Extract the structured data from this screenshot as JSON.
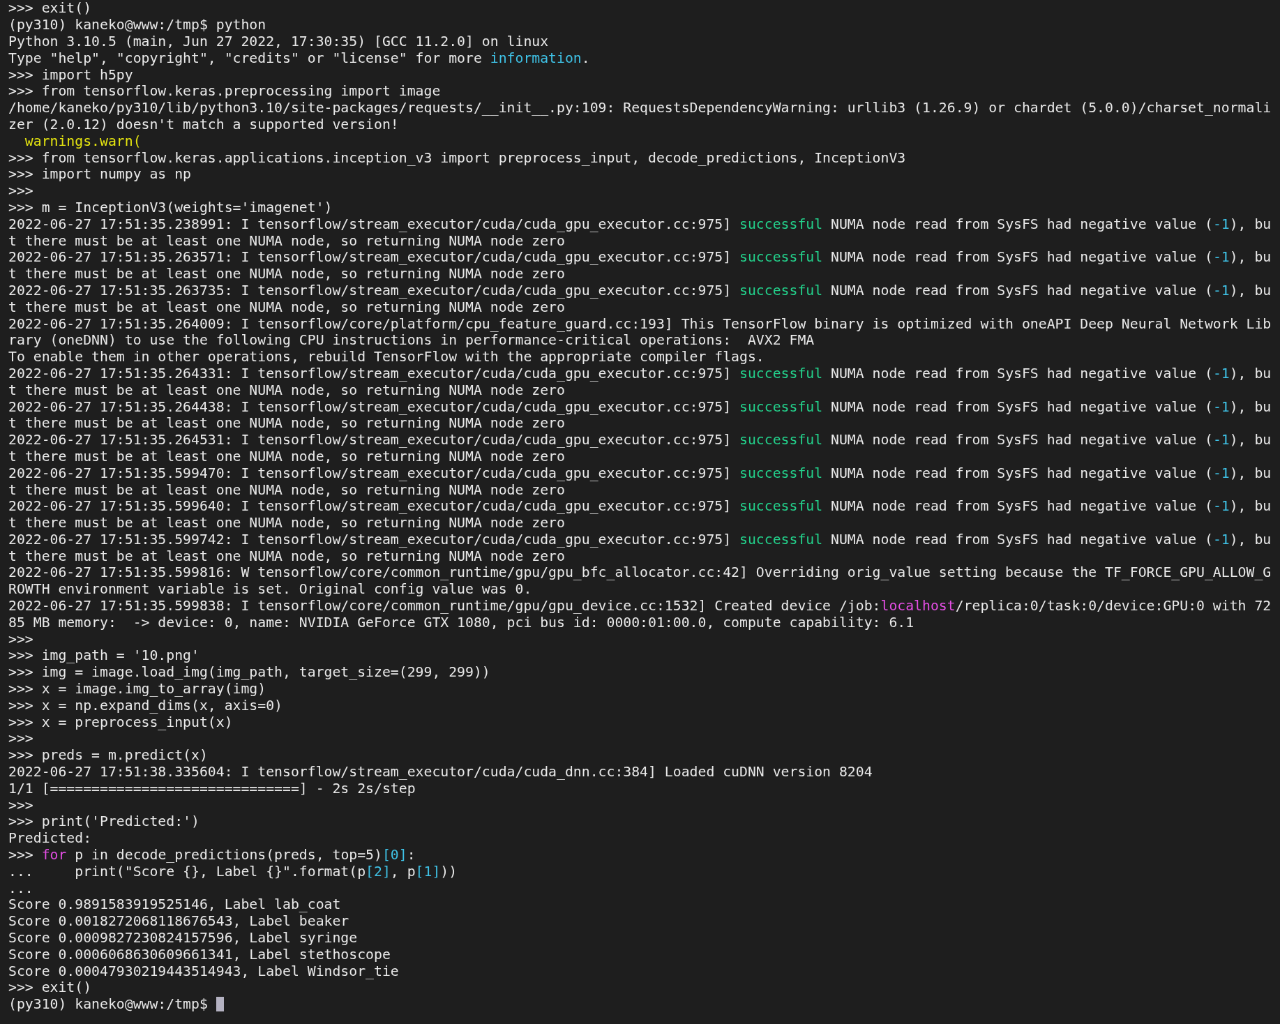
{
  "terminal": {
    "cursor": true,
    "lines": [
      {
        "segments": [
          {
            "text": ">>> exit()"
          }
        ]
      },
      {
        "segments": [
          {
            "text": "(py310) kaneko@www:/tmp$ python"
          }
        ]
      },
      {
        "segments": [
          {
            "text": "Python 3.10.5 (main, Jun 27 2022, 17:30:35) [GCC 11.2.0] on linux"
          }
        ]
      },
      {
        "segments": [
          {
            "text": "Type \"help\", \"copyright\", \"credits\" or \"license\" for more "
          },
          {
            "text": "information",
            "color": "#3fc2e6"
          },
          {
            "text": "."
          }
        ]
      },
      {
        "segments": [
          {
            "text": ">>> import h5py"
          }
        ]
      },
      {
        "segments": [
          {
            "text": ">>> from tensorflow.keras.preprocessing import image"
          }
        ]
      },
      {
        "segments": [
          {
            "text": "/home/kaneko/py310/lib/python3.10/site-packages/requests/__init__.py:109: RequestsDependencyWarning: urllib3 (1.26.9) or chardet (5.0.0)/charset_normali"
          }
        ]
      },
      {
        "segments": [
          {
            "text": "zer (2.0.12) doesn't match a supported version!"
          }
        ]
      },
      {
        "segments": [
          {
            "text": "  warnings.warn(",
            "color": "#e5e510"
          }
        ]
      },
      {
        "segments": [
          {
            "text": ">>> from tensorflow.keras.applications.inception_v3 import preprocess_input, decode_predictions, InceptionV3"
          }
        ]
      },
      {
        "segments": [
          {
            "text": ">>> import numpy as np"
          }
        ]
      },
      {
        "segments": [
          {
            "text": ">>>"
          }
        ]
      },
      {
        "segments": [
          {
            "text": ">>> m = InceptionV3(weights='imagenet')"
          }
        ]
      },
      {
        "segments": [
          {
            "text": "2022-06-27 17:51:35.238991: I tensorflow/stream_executor/cuda/cuda_gpu_executor.cc:975] "
          },
          {
            "text": "successful",
            "color": "#23d18b"
          },
          {
            "text": " NUMA node read from SysFS had negative value ("
          },
          {
            "text": "-1",
            "color": "#3fc2e6"
          },
          {
            "text": "), bu"
          }
        ]
      },
      {
        "segments": [
          {
            "text": "t there must be at least one NUMA node, so returning NUMA node zero"
          }
        ]
      },
      {
        "segments": [
          {
            "text": "2022-06-27 17:51:35.263571: I tensorflow/stream_executor/cuda/cuda_gpu_executor.cc:975] "
          },
          {
            "text": "successful",
            "color": "#23d18b"
          },
          {
            "text": " NUMA node read from SysFS had negative value ("
          },
          {
            "text": "-1",
            "color": "#3fc2e6"
          },
          {
            "text": "), bu"
          }
        ]
      },
      {
        "segments": [
          {
            "text": "t there must be at least one NUMA node, so returning NUMA node zero"
          }
        ]
      },
      {
        "segments": [
          {
            "text": "2022-06-27 17:51:35.263735: I tensorflow/stream_executor/cuda/cuda_gpu_executor.cc:975] "
          },
          {
            "text": "successful",
            "color": "#23d18b"
          },
          {
            "text": " NUMA node read from SysFS had negative value ("
          },
          {
            "text": "-1",
            "color": "#3fc2e6"
          },
          {
            "text": "), bu"
          }
        ]
      },
      {
        "segments": [
          {
            "text": "t there must be at least one NUMA node, so returning NUMA node zero"
          }
        ]
      },
      {
        "segments": [
          {
            "text": "2022-06-27 17:51:35.264009: I tensorflow/core/platform/cpu_feature_guard.cc:193] This TensorFlow binary is optimized with oneAPI Deep Neural Network Lib"
          }
        ]
      },
      {
        "segments": [
          {
            "text": "rary (oneDNN) to use the following CPU instructions in performance-critical operations:  AVX2 FMA"
          }
        ]
      },
      {
        "segments": [
          {
            "text": "To enable them in other operations, rebuild TensorFlow with the appropriate compiler flags."
          }
        ]
      },
      {
        "segments": [
          {
            "text": "2022-06-27 17:51:35.264331: I tensorflow/stream_executor/cuda/cuda_gpu_executor.cc:975] "
          },
          {
            "text": "successful",
            "color": "#23d18b"
          },
          {
            "text": " NUMA node read from SysFS had negative value ("
          },
          {
            "text": "-1",
            "color": "#3fc2e6"
          },
          {
            "text": "), bu"
          }
        ]
      },
      {
        "segments": [
          {
            "text": "t there must be at least one NUMA node, so returning NUMA node zero"
          }
        ]
      },
      {
        "segments": [
          {
            "text": "2022-06-27 17:51:35.264438: I tensorflow/stream_executor/cuda/cuda_gpu_executor.cc:975] "
          },
          {
            "text": "successful",
            "color": "#23d18b"
          },
          {
            "text": " NUMA node read from SysFS had negative value ("
          },
          {
            "text": "-1",
            "color": "#3fc2e6"
          },
          {
            "text": "), bu"
          }
        ]
      },
      {
        "segments": [
          {
            "text": "t there must be at least one NUMA node, so returning NUMA node zero"
          }
        ]
      },
      {
        "segments": [
          {
            "text": "2022-06-27 17:51:35.264531: I tensorflow/stream_executor/cuda/cuda_gpu_executor.cc:975] "
          },
          {
            "text": "successful",
            "color": "#23d18b"
          },
          {
            "text": " NUMA node read from SysFS had negative value ("
          },
          {
            "text": "-1",
            "color": "#3fc2e6"
          },
          {
            "text": "), bu"
          }
        ]
      },
      {
        "segments": [
          {
            "text": "t there must be at least one NUMA node, so returning NUMA node zero"
          }
        ]
      },
      {
        "segments": [
          {
            "text": "2022-06-27 17:51:35.599470: I tensorflow/stream_executor/cuda/cuda_gpu_executor.cc:975] "
          },
          {
            "text": "successful",
            "color": "#23d18b"
          },
          {
            "text": " NUMA node read from SysFS had negative value ("
          },
          {
            "text": "-1",
            "color": "#3fc2e6"
          },
          {
            "text": "), bu"
          }
        ]
      },
      {
        "segments": [
          {
            "text": "t there must be at least one NUMA node, so returning NUMA node zero"
          }
        ]
      },
      {
        "segments": [
          {
            "text": "2022-06-27 17:51:35.599640: I tensorflow/stream_executor/cuda/cuda_gpu_executor.cc:975] "
          },
          {
            "text": "successful",
            "color": "#23d18b"
          },
          {
            "text": " NUMA node read from SysFS had negative value ("
          },
          {
            "text": "-1",
            "color": "#3fc2e6"
          },
          {
            "text": "), bu"
          }
        ]
      },
      {
        "segments": [
          {
            "text": "t there must be at least one NUMA node, so returning NUMA node zero"
          }
        ]
      },
      {
        "segments": [
          {
            "text": "2022-06-27 17:51:35.599742: I tensorflow/stream_executor/cuda/cuda_gpu_executor.cc:975] "
          },
          {
            "text": "successful",
            "color": "#23d18b"
          },
          {
            "text": " NUMA node read from SysFS had negative value ("
          },
          {
            "text": "-1",
            "color": "#3fc2e6"
          },
          {
            "text": "), bu"
          }
        ]
      },
      {
        "segments": [
          {
            "text": "t there must be at least one NUMA node, so returning NUMA node zero"
          }
        ]
      },
      {
        "segments": [
          {
            "text": "2022-06-27 17:51:35.599816: W tensorflow/core/common_runtime/gpu/gpu_bfc_allocator.cc:42] Overriding orig_value setting because the TF_FORCE_GPU_ALLOW_G"
          }
        ]
      },
      {
        "segments": [
          {
            "text": "ROWTH environment variable is set. Original config value was 0."
          }
        ]
      },
      {
        "segments": [
          {
            "text": "2022-06-27 17:51:35.599838: I tensorflow/core/common_runtime/gpu/gpu_device.cc:1532] Created device /job:"
          },
          {
            "text": "localhost",
            "color": "#e44ee4"
          },
          {
            "text": "/replica:0/task:0/device:GPU:0 with 72"
          }
        ]
      },
      {
        "segments": [
          {
            "text": "85 MB memory:  -> device: 0, name: NVIDIA GeForce GTX 1080, pci bus id: 0000:01:00.0, compute capability: 6.1"
          }
        ]
      },
      {
        "segments": [
          {
            "text": ">>>"
          }
        ]
      },
      {
        "segments": [
          {
            "text": ">>> img_path = '10.png'"
          }
        ]
      },
      {
        "segments": [
          {
            "text": ">>> img = image.load_img(img_path, target_size=(299, 299))"
          }
        ]
      },
      {
        "segments": [
          {
            "text": ">>> x = image.img_to_array(img)"
          }
        ]
      },
      {
        "segments": [
          {
            "text": ">>> x = np.expand_dims(x, axis=0)"
          }
        ]
      },
      {
        "segments": [
          {
            "text": ">>> x = preprocess_input(x)"
          }
        ]
      },
      {
        "segments": [
          {
            "text": ">>>"
          }
        ]
      },
      {
        "segments": [
          {
            "text": ">>> preds = m.predict(x)"
          }
        ]
      },
      {
        "segments": [
          {
            "text": "2022-06-27 17:51:38.335604: I tensorflow/stream_executor/cuda/cuda_dnn.cc:384] Loaded cuDNN version 8204"
          }
        ]
      },
      {
        "segments": [
          {
            "text": "1/1 [==============================] - 2s 2s/step"
          }
        ]
      },
      {
        "segments": [
          {
            "text": ">>>"
          }
        ]
      },
      {
        "segments": [
          {
            "text": ">>> print('Predicted:')"
          }
        ]
      },
      {
        "segments": [
          {
            "text": "Predicted:"
          }
        ]
      },
      {
        "segments": [
          {
            "text": ">>> "
          },
          {
            "text": "for",
            "color": "#e44ee4"
          },
          {
            "text": " p in decode_predictions(preds, top=5)"
          },
          {
            "text": "[0]",
            "color": "#3fc2e6"
          },
          {
            "text": ":"
          }
        ]
      },
      {
        "segments": [
          {
            "text": "...     print(\"Score {}, Label {}\".format(p"
          },
          {
            "text": "[2]",
            "color": "#3fc2e6"
          },
          {
            "text": ", p"
          },
          {
            "text": "[1]",
            "color": "#3fc2e6"
          },
          {
            "text": "))"
          }
        ]
      },
      {
        "segments": [
          {
            "text": "..."
          }
        ]
      },
      {
        "segments": [
          {
            "text": "Score 0.9891583919525146, Label lab_coat"
          }
        ]
      },
      {
        "segments": [
          {
            "text": "Score 0.0018272068118676543, Label beaker"
          }
        ]
      },
      {
        "segments": [
          {
            "text": "Score 0.0009827230824157596, Label syringe"
          }
        ]
      },
      {
        "segments": [
          {
            "text": "Score 0.0006068630609661341, Label stethoscope"
          }
        ]
      },
      {
        "segments": [
          {
            "text": "Score 0.00047930219443514943, Label Windsor_tie"
          }
        ]
      },
      {
        "segments": [
          {
            "text": ">>> exit()"
          }
        ]
      },
      {
        "segments": [
          {
            "text": "(py310) kaneko@www:/tmp$ "
          }
        ]
      }
    ]
  }
}
